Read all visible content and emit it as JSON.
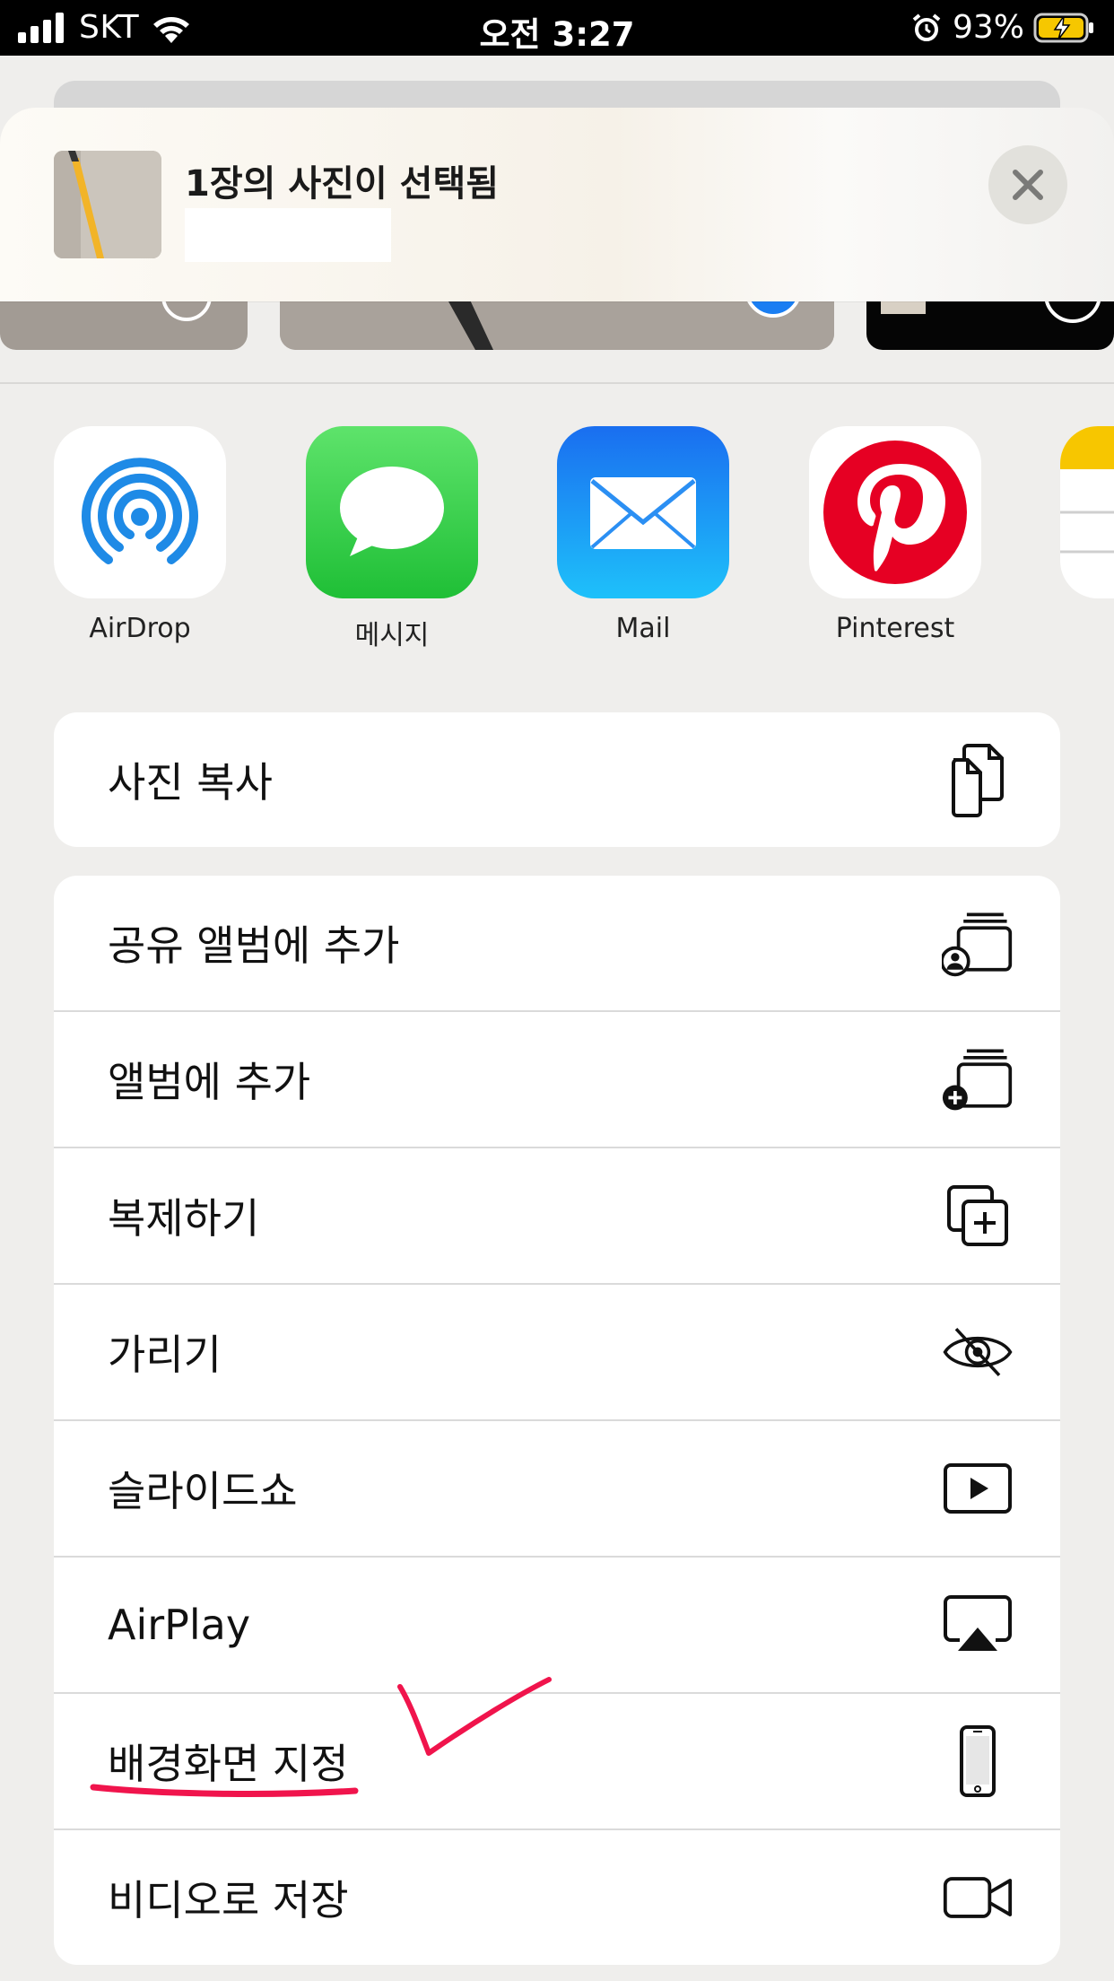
{
  "status_bar": {
    "carrier": "SKT",
    "time": "오전 3:27",
    "battery": "93%"
  },
  "share_sheet": {
    "title": "1장의 사진이 선택됨",
    "close_icon": "close-icon"
  },
  "apps": [
    {
      "label": "AirDrop",
      "icon": "airdrop-icon"
    },
    {
      "label": "메시지",
      "icon": "messages-icon"
    },
    {
      "label": "Mail",
      "icon": "mail-icon"
    },
    {
      "label": "Pinterest",
      "icon": "pinterest-icon"
    }
  ],
  "actions_group1": [
    {
      "label": "사진 복사",
      "icon": "copy-icon"
    }
  ],
  "actions_group2": [
    {
      "label": "공유 앨범에 추가",
      "icon": "shared-album-icon"
    },
    {
      "label": "앨범에 추가",
      "icon": "add-album-icon"
    },
    {
      "label": "복제하기",
      "icon": "duplicate-icon"
    },
    {
      "label": "가리기",
      "icon": "hide-icon"
    },
    {
      "label": "슬라이드쇼",
      "icon": "slideshow-icon"
    },
    {
      "label": "AirPlay",
      "icon": "airplay-icon"
    },
    {
      "label": "배경화면 지정",
      "icon": "iphone-icon"
    },
    {
      "label": "비디오로 저장",
      "icon": "video-camera-icon"
    }
  ],
  "colors": {
    "pinterest": "#e60023",
    "messages": "#34c759",
    "mail": "#1e88f5",
    "airdrop": "#1e8ae6",
    "annotation": "#f0144c"
  }
}
